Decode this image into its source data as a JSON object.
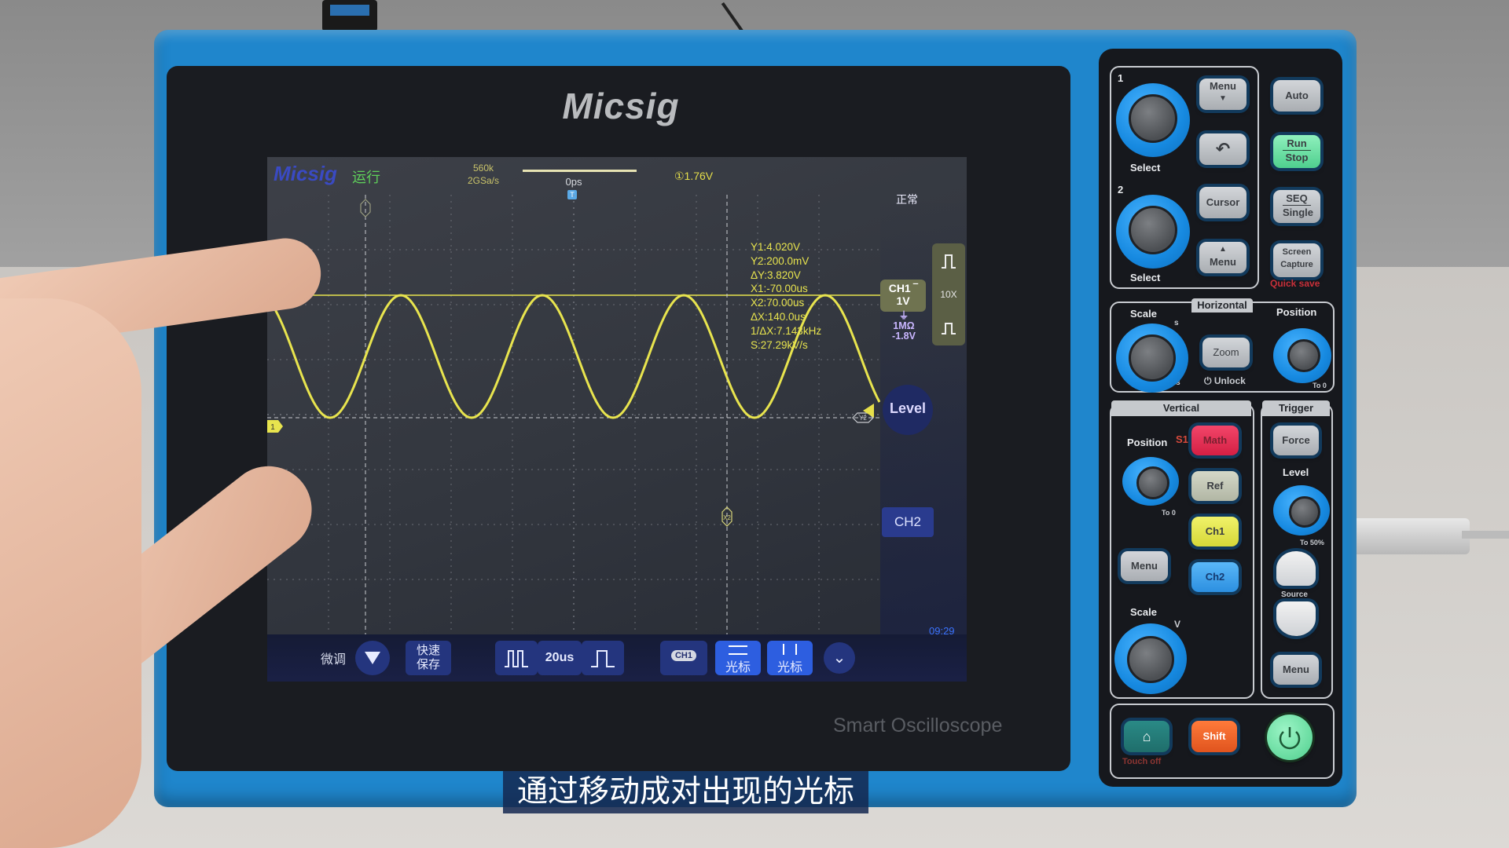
{
  "device": {
    "brand": "Micsig",
    "model_tagline": "Smart Oscilloscope"
  },
  "screen": {
    "topbar": {
      "logo": "Micsig",
      "run_state": "运行",
      "memory_depth": "560k",
      "sample_rate": "2GSa/s",
      "trigger_position": "0ps",
      "trigger_marker": "T",
      "trigger_level": "①1.76V",
      "acquisition_mode": "正常"
    },
    "cursor_readout": {
      "y1": "Y1:4.020V",
      "y2": "Y2:200.0mV",
      "dy": "ΔY:3.820V",
      "x1": "X1:-70.00us",
      "x2": "X2:70.00us",
      "dx": "ΔX:140.0us",
      "inv_dx": "1/ΔX:7.143kHz",
      "slope": "S:27.29kV/s"
    },
    "ch1": {
      "label": "CH1",
      "scale": "1V",
      "coupling_symbol": "⏚",
      "impedance": "1MΩ",
      "offset": "-1.8V",
      "color": "#e8e44e",
      "ground_marker": "1"
    },
    "probe_panel": {
      "attenuation": "10X"
    },
    "cursor_markers": {
      "y2": "Y2",
      "x2": "X2"
    },
    "level_button": "Level",
    "ch2_button": "CH2",
    "clock": "09:29",
    "bottombar": {
      "fine_tune": "微调",
      "quick_save_line1": "快速",
      "quick_save_line2": "保存",
      "timebase": "20us",
      "channel_badge": "CH1",
      "h_cursor": "光标",
      "v_cursor": "光标"
    }
  },
  "controls": {
    "multipurpose": {
      "knob1_label": "1",
      "knob2_label": "2",
      "select1": "Select",
      "select2": "Select",
      "menu_down": "Menu",
      "back_icon": "↶",
      "cursor": "Cursor",
      "menu_up": "Menu"
    },
    "right_keys": {
      "auto": "Auto",
      "run": "Run",
      "stop": "Stop",
      "seq": "SEQ",
      "single": "Single",
      "screen": "Screen",
      "capture": "Capture",
      "quick_save": "Quick save"
    },
    "horizontal": {
      "title": "Horizontal",
      "scale": "Scale",
      "position": "Position",
      "zoom": "Zoom",
      "unlock": "⏻ Unlock",
      "s_mark": "s",
      "ns_mark": "ns",
      "to0": "To 0"
    },
    "vertical": {
      "title": "Vertical",
      "position": "Position",
      "s1": "S1",
      "math": "Math",
      "ref": "Ref",
      "ch1": "Ch1",
      "ch2": "Ch2",
      "menu": "Menu",
      "scale": "Scale",
      "to0": "To 0",
      "v_mark": "V"
    },
    "trigger": {
      "title": "Trigger",
      "force": "Force",
      "level": "Level",
      "to50": "To 50%",
      "source": "Source",
      "menu": "Menu"
    },
    "bottom": {
      "touch_off": "Touch off",
      "shift": "Shift"
    },
    "colors": {
      "run_stop": "#6fe0a6",
      "math": "#e8264d",
      "ch1": "#e5e84a",
      "ch2": "#3aa0f0",
      "shift": "#f06a2a",
      "power": "#5fe09a"
    }
  },
  "subtitle": "通过移动成对出现的光标"
}
